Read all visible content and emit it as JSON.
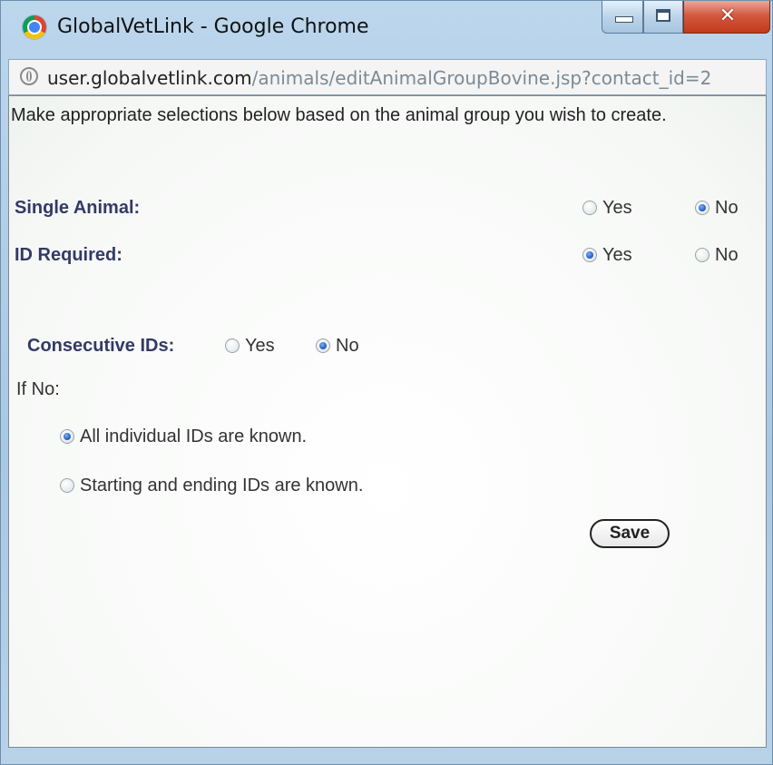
{
  "window": {
    "title": "GlobalVetLink - Google Chrome",
    "icon": "chrome-icon"
  },
  "address_bar": {
    "host": "user.globalvetlink.com",
    "path": "/animals/editAnimalGroupBovine.jsp?contact_id=2"
  },
  "form": {
    "intro": "Make appropriate selections below based on the animal group you wish to create.",
    "single_animal": {
      "label": "Single Animal:",
      "yes": "Yes",
      "no": "No",
      "selected": "No"
    },
    "id_required": {
      "label": "ID Required:",
      "yes": "Yes",
      "no": "No",
      "selected": "Yes"
    },
    "consecutive_ids": {
      "label": "Consecutive IDs:",
      "yes": "Yes",
      "no": "No",
      "selected": "No"
    },
    "if_no_label": "If No:",
    "id_options": [
      {
        "label": "All individual IDs are known.",
        "selected": true
      },
      {
        "label": "Starting and ending IDs are known.",
        "selected": false
      }
    ],
    "save_label": "Save"
  },
  "colors": {
    "label_text": "#333a66",
    "radio_selected": "#2563c9",
    "close_button": "#c2391c"
  }
}
